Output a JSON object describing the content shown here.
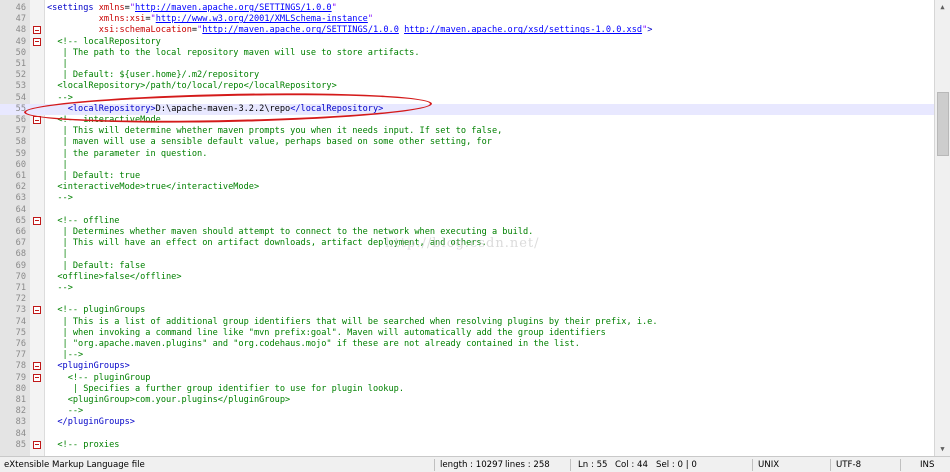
{
  "editor": {
    "lines": [
      {
        "no": "46",
        "fold": false,
        "current": false,
        "tokens": [
          {
            "c": "k",
            "t": "<settings "
          },
          {
            "c": "a",
            "t": "xmlns"
          },
          {
            "c": "t",
            "t": "="
          },
          {
            "c": "v",
            "t": "\""
          },
          {
            "c": "u",
            "t": "http://maven.apache.org/SETTINGS/1.0.0"
          },
          {
            "c": "v",
            "t": "\""
          }
        ]
      },
      {
        "no": "47",
        "fold": false,
        "current": false,
        "tokens": [
          {
            "c": "t",
            "t": "          "
          },
          {
            "c": "a",
            "t": "xmlns:xsi"
          },
          {
            "c": "t",
            "t": "="
          },
          {
            "c": "v",
            "t": "\""
          },
          {
            "c": "u",
            "t": "http://www.w3.org/2001/XMLSchema-instance"
          },
          {
            "c": "v",
            "t": "\""
          }
        ]
      },
      {
        "no": "48",
        "fold": true,
        "current": false,
        "tokens": [
          {
            "c": "t",
            "t": "          "
          },
          {
            "c": "a",
            "t": "xsi:schemaLocation"
          },
          {
            "c": "t",
            "t": "="
          },
          {
            "c": "v",
            "t": "\""
          },
          {
            "c": "u",
            "t": "http://maven.apache.org/SETTINGS/1.0.0"
          },
          {
            "c": "v",
            "t": " "
          },
          {
            "c": "u",
            "t": "http://maven.apache.org/xsd/settings-1.0.0.xsd"
          },
          {
            "c": "v",
            "t": "\""
          },
          {
            "c": "k",
            "t": ">"
          }
        ]
      },
      {
        "no": "49",
        "fold": true,
        "current": false,
        "tokens": [
          {
            "c": "c",
            "t": "  <!-- localRepository"
          }
        ]
      },
      {
        "no": "50",
        "fold": false,
        "current": false,
        "tokens": [
          {
            "c": "c",
            "t": "   | The path to the local repository maven will use to store artifacts."
          }
        ]
      },
      {
        "no": "51",
        "fold": false,
        "current": false,
        "tokens": [
          {
            "c": "c",
            "t": "   |"
          }
        ]
      },
      {
        "no": "52",
        "fold": false,
        "current": false,
        "tokens": [
          {
            "c": "c",
            "t": "   | Default: ${user.home}/.m2/repository"
          }
        ]
      },
      {
        "no": "53",
        "fold": false,
        "current": false,
        "tokens": [
          {
            "c": "c",
            "t": "  <localRepository>/path/to/local/repo</localRepository>"
          }
        ]
      },
      {
        "no": "54",
        "fold": false,
        "current": false,
        "tokens": [
          {
            "c": "c",
            "t": "  -->"
          }
        ]
      },
      {
        "no": "55",
        "fold": false,
        "current": true,
        "tokens": [
          {
            "c": "t",
            "t": "    "
          },
          {
            "c": "k",
            "t": "<localRepository>"
          },
          {
            "c": "t",
            "t": "D:\\apache-maven-3.2.2\\repo"
          },
          {
            "c": "k",
            "t": "</localRepository>"
          }
        ]
      },
      {
        "no": "56",
        "fold": true,
        "current": false,
        "tokens": [
          {
            "c": "c",
            "t": "  <!-- interactiveMode"
          }
        ]
      },
      {
        "no": "57",
        "fold": false,
        "current": false,
        "tokens": [
          {
            "c": "c",
            "t": "   | This will determine whether maven prompts you when it needs input. If set to false,"
          }
        ]
      },
      {
        "no": "58",
        "fold": false,
        "current": false,
        "tokens": [
          {
            "c": "c",
            "t": "   | maven will use a sensible default value, perhaps based on some other setting, for"
          }
        ]
      },
      {
        "no": "59",
        "fold": false,
        "current": false,
        "tokens": [
          {
            "c": "c",
            "t": "   | the parameter in question."
          }
        ]
      },
      {
        "no": "60",
        "fold": false,
        "current": false,
        "tokens": [
          {
            "c": "c",
            "t": "   |"
          }
        ]
      },
      {
        "no": "61",
        "fold": false,
        "current": false,
        "tokens": [
          {
            "c": "c",
            "t": "   | Default: true"
          }
        ]
      },
      {
        "no": "62",
        "fold": false,
        "current": false,
        "tokens": [
          {
            "c": "c",
            "t": "  <interactiveMode>true</interactiveMode>"
          }
        ]
      },
      {
        "no": "63",
        "fold": false,
        "current": false,
        "tokens": [
          {
            "c": "c",
            "t": "  -->"
          }
        ]
      },
      {
        "no": "64",
        "fold": false,
        "current": false,
        "tokens": []
      },
      {
        "no": "65",
        "fold": true,
        "current": false,
        "tokens": [
          {
            "c": "c",
            "t": "  <!-- offline"
          }
        ]
      },
      {
        "no": "66",
        "fold": false,
        "current": false,
        "tokens": [
          {
            "c": "c",
            "t": "   | Determines whether maven should attempt to connect to the network when executing a build."
          }
        ]
      },
      {
        "no": "67",
        "fold": false,
        "current": false,
        "tokens": [
          {
            "c": "c",
            "t": "   | This will have an effect on artifact downloads, artifact deployment, and others."
          }
        ]
      },
      {
        "no": "68",
        "fold": false,
        "current": false,
        "tokens": [
          {
            "c": "c",
            "t": "   |"
          }
        ]
      },
      {
        "no": "69",
        "fold": false,
        "current": false,
        "tokens": [
          {
            "c": "c",
            "t": "   | Default: false"
          }
        ]
      },
      {
        "no": "70",
        "fold": false,
        "current": false,
        "tokens": [
          {
            "c": "c",
            "t": "  <offline>false</offline>"
          }
        ]
      },
      {
        "no": "71",
        "fold": false,
        "current": false,
        "tokens": [
          {
            "c": "c",
            "t": "  -->"
          }
        ]
      },
      {
        "no": "72",
        "fold": false,
        "current": false,
        "tokens": []
      },
      {
        "no": "73",
        "fold": true,
        "current": false,
        "tokens": [
          {
            "c": "c",
            "t": "  <!-- pluginGroups"
          }
        ]
      },
      {
        "no": "74",
        "fold": false,
        "current": false,
        "tokens": [
          {
            "c": "c",
            "t": "   | This is a list of additional group identifiers that will be searched when resolving plugins by their prefix, i.e."
          }
        ]
      },
      {
        "no": "75",
        "fold": false,
        "current": false,
        "tokens": [
          {
            "c": "c",
            "t": "   | when invoking a command line like \"mvn prefix:goal\". Maven will automatically add the group identifiers"
          }
        ]
      },
      {
        "no": "76",
        "fold": false,
        "current": false,
        "tokens": [
          {
            "c": "c",
            "t": "   | \"org.apache.maven.plugins\" and \"org.codehaus.mojo\" if these are not already contained in the list."
          }
        ]
      },
      {
        "no": "77",
        "fold": false,
        "current": false,
        "tokens": [
          {
            "c": "c",
            "t": "   |-->"
          }
        ]
      },
      {
        "no": "78",
        "fold": true,
        "current": false,
        "tokens": [
          {
            "c": "t",
            "t": "  "
          },
          {
            "c": "k",
            "t": "<pluginGroups>"
          }
        ]
      },
      {
        "no": "79",
        "fold": true,
        "current": false,
        "tokens": [
          {
            "c": "c",
            "t": "    <!-- pluginGroup"
          }
        ]
      },
      {
        "no": "80",
        "fold": false,
        "current": false,
        "tokens": [
          {
            "c": "c",
            "t": "     | Specifies a further group identifier to use for plugin lookup."
          }
        ]
      },
      {
        "no": "81",
        "fold": false,
        "current": false,
        "tokens": [
          {
            "c": "c",
            "t": "    <pluginGroup>com.your.plugins</pluginGroup>"
          }
        ]
      },
      {
        "no": "82",
        "fold": false,
        "current": false,
        "tokens": [
          {
            "c": "c",
            "t": "    -->"
          }
        ]
      },
      {
        "no": "83",
        "fold": false,
        "current": false,
        "tokens": [
          {
            "c": "t",
            "t": "  "
          },
          {
            "c": "k",
            "t": "</pluginGroups>"
          }
        ]
      },
      {
        "no": "84",
        "fold": false,
        "current": false,
        "tokens": []
      },
      {
        "no": "85",
        "fold": true,
        "current": false,
        "tokens": [
          {
            "c": "c",
            "t": "  <!-- proxies"
          }
        ]
      }
    ]
  },
  "watermark": "http://blog.csdn.net/",
  "statusbar": {
    "file_type": "eXtensible Markup Language file",
    "length": "length : 10297",
    "lines": "lines : 258",
    "ln": "Ln : 55",
    "col": "Col : 44",
    "sel": "Sel : 0 | 0",
    "eol": "UNIX",
    "encoding": "UTF-8",
    "mode": "INS"
  },
  "colors": {
    "tag": "#0000c8",
    "attribute": "#c80000",
    "url": "#0000ff",
    "comment": "#008000",
    "annotation": "#d41a1a"
  }
}
